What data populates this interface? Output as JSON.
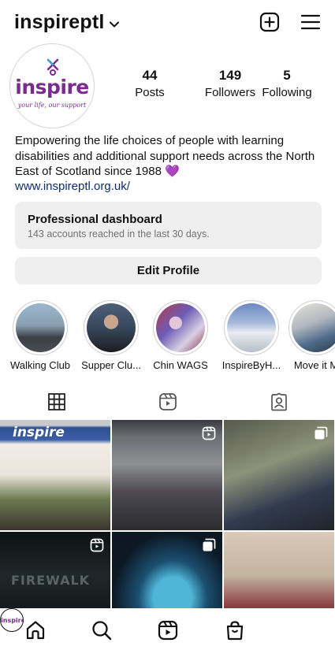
{
  "header": {
    "username": "inspireptl",
    "icons": {
      "dropdown": "chevron-down-icon",
      "create": "plus-square-icon",
      "menu": "hamburger-menu-icon"
    }
  },
  "profile": {
    "avatar_logo_text": "inspire",
    "avatar_tagline": "your life, our support",
    "stats": [
      {
        "value": "44",
        "label": "Posts"
      },
      {
        "value": "149",
        "label": "Followers"
      },
      {
        "value": "5",
        "label": "Following"
      }
    ],
    "bio": "Empowering the life choices of people with learning disabilities and additional support needs across the North East of Scotland since 1988",
    "bio_emoji": "💜",
    "link": "www.inspireptl.org.uk/"
  },
  "dashboard": {
    "title": "Professional dashboard",
    "subtitle": "143 accounts reached in the last 30 days."
  },
  "edit_profile_label": "Edit Profile",
  "highlights": [
    {
      "label": "Walking Club"
    },
    {
      "label": "Supper Clu..."
    },
    {
      "label": "Chin WAGS"
    },
    {
      "label": "InspireByH..."
    },
    {
      "label": "Move it M"
    }
  ],
  "tabs": [
    {
      "icon": "grid-icon"
    },
    {
      "icon": "reels-icon"
    },
    {
      "icon": "tagged-icon"
    }
  ],
  "grid_tiles": [
    {
      "overlay_text": "inspire",
      "badge": ""
    },
    {
      "overlay_text": "",
      "badge": "reels-icon"
    },
    {
      "overlay_text": "",
      "badge": "carousel-icon"
    },
    {
      "overlay_text": "FIREWALK",
      "badge": "reels-icon"
    },
    {
      "overlay_text": "",
      "badge": "carousel-icon"
    },
    {
      "overlay_text": "",
      "badge": ""
    }
  ],
  "bottom_nav": {
    "icons": [
      "home-icon",
      "search-icon",
      "reels-icon",
      "shop-icon",
      "profile-avatar"
    ],
    "profile_avatar_text": "inspire"
  },
  "colors": {
    "brand_purple": "#7a2b8f",
    "button_bg": "#efefef",
    "link": "#0d2e6e",
    "secondary_text": "#737373"
  }
}
